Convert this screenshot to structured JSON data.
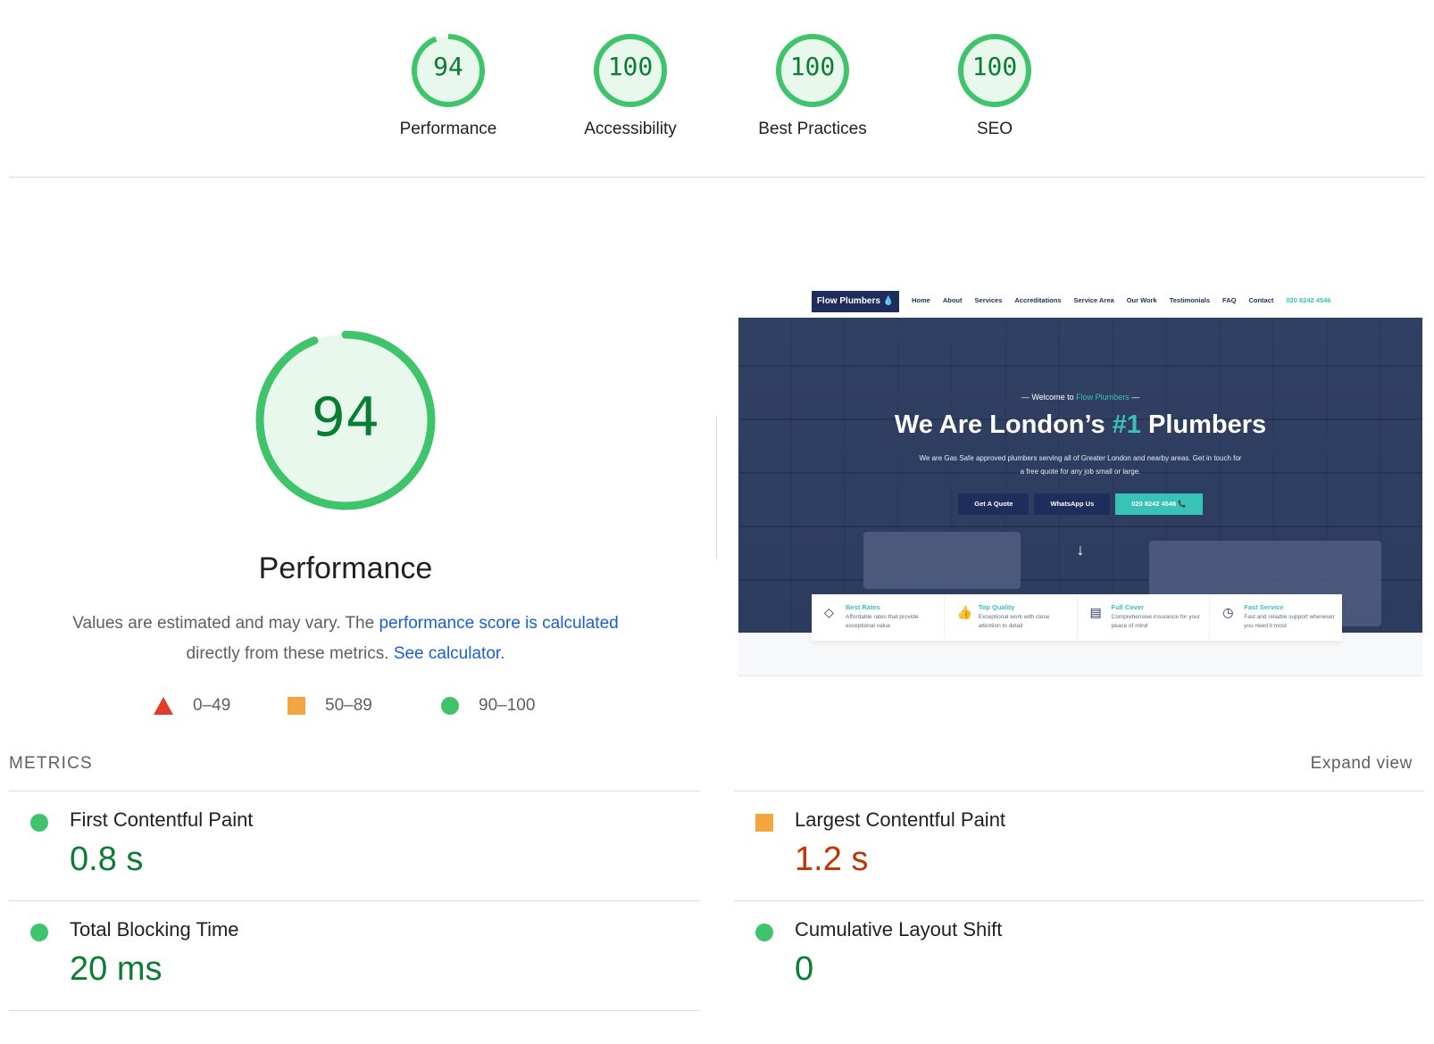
{
  "colors": {
    "pass": "#3fc46b",
    "pass_text": "#0b7d33",
    "average": "#f2a541",
    "average_text": "#c33300",
    "fail": "#e23d2b",
    "link": "#1a5fd1"
  },
  "categories": [
    {
      "score": "94",
      "score_value": 94,
      "label": "Performance"
    },
    {
      "score": "100",
      "score_value": 100,
      "label": "Accessibility"
    },
    {
      "score": "100",
      "score_value": 100,
      "label": "Best Practices"
    },
    {
      "score": "100",
      "score_value": 100,
      "label": "SEO"
    }
  ],
  "performance": {
    "score": "94",
    "score_value": 94,
    "title": "Performance",
    "desc_text_1": "Values are estimated and may vary. The ",
    "desc_link_1": "performance score is calculated",
    "desc_text_2": "directly from these metrics. ",
    "desc_link_2": "See calculator."
  },
  "legend": [
    {
      "shape": "triangle",
      "range": "0–49"
    },
    {
      "shape": "square",
      "range": "50–89"
    },
    {
      "shape": "circle",
      "range": "90–100"
    }
  ],
  "preview": {
    "logo": "Flow Plumbers 💧",
    "nav": [
      "Home",
      "About",
      "Services",
      "Accreditations",
      "Service Area",
      "Our Work",
      "Testimonials",
      "FAQ",
      "Contact"
    ],
    "phone": "020 8242 4546",
    "welcome_prefix": "Welcome to ",
    "welcome_brand": "Flow Plumbers",
    "headline_1": "We Are London’s ",
    "headline_accent": "#1",
    "headline_2": " Plumbers",
    "subtitle": "We are Gas Safe approved plumbers serving all of Greater London and nearby areas. Get in touch for a free quote for any job small or large.",
    "buttons": [
      "Get A Quote",
      "WhatsApp Us",
      "020 8242 4546 📞"
    ],
    "arrow": "↓",
    "features": [
      {
        "icon": "tag-icon",
        "title": "Best Rates",
        "desc": "Affordable rates that provide exceptional value"
      },
      {
        "icon": "thumbs-up-icon",
        "title": "Top Quality",
        "desc": "Exceptional work with close attention to detail"
      },
      {
        "icon": "document-icon",
        "title": "Full Cover",
        "desc": "Comprehensive insurance for your peace of mind"
      },
      {
        "icon": "clock-icon",
        "title": "Fast Service",
        "desc": "Fast and reliable support whenever you need it most"
      }
    ]
  },
  "metrics": {
    "heading": "METRICS",
    "expand": "Expand view",
    "items": [
      {
        "name": "First Contentful Paint",
        "value": "0.8 s",
        "rating": "pass"
      },
      {
        "name": "Largest Contentful Paint",
        "value": "1.2 s",
        "rating": "average"
      },
      {
        "name": "Total Blocking Time",
        "value": "20 ms",
        "rating": "pass"
      },
      {
        "name": "Cumulative Layout Shift",
        "value": "0",
        "rating": "pass"
      }
    ]
  }
}
